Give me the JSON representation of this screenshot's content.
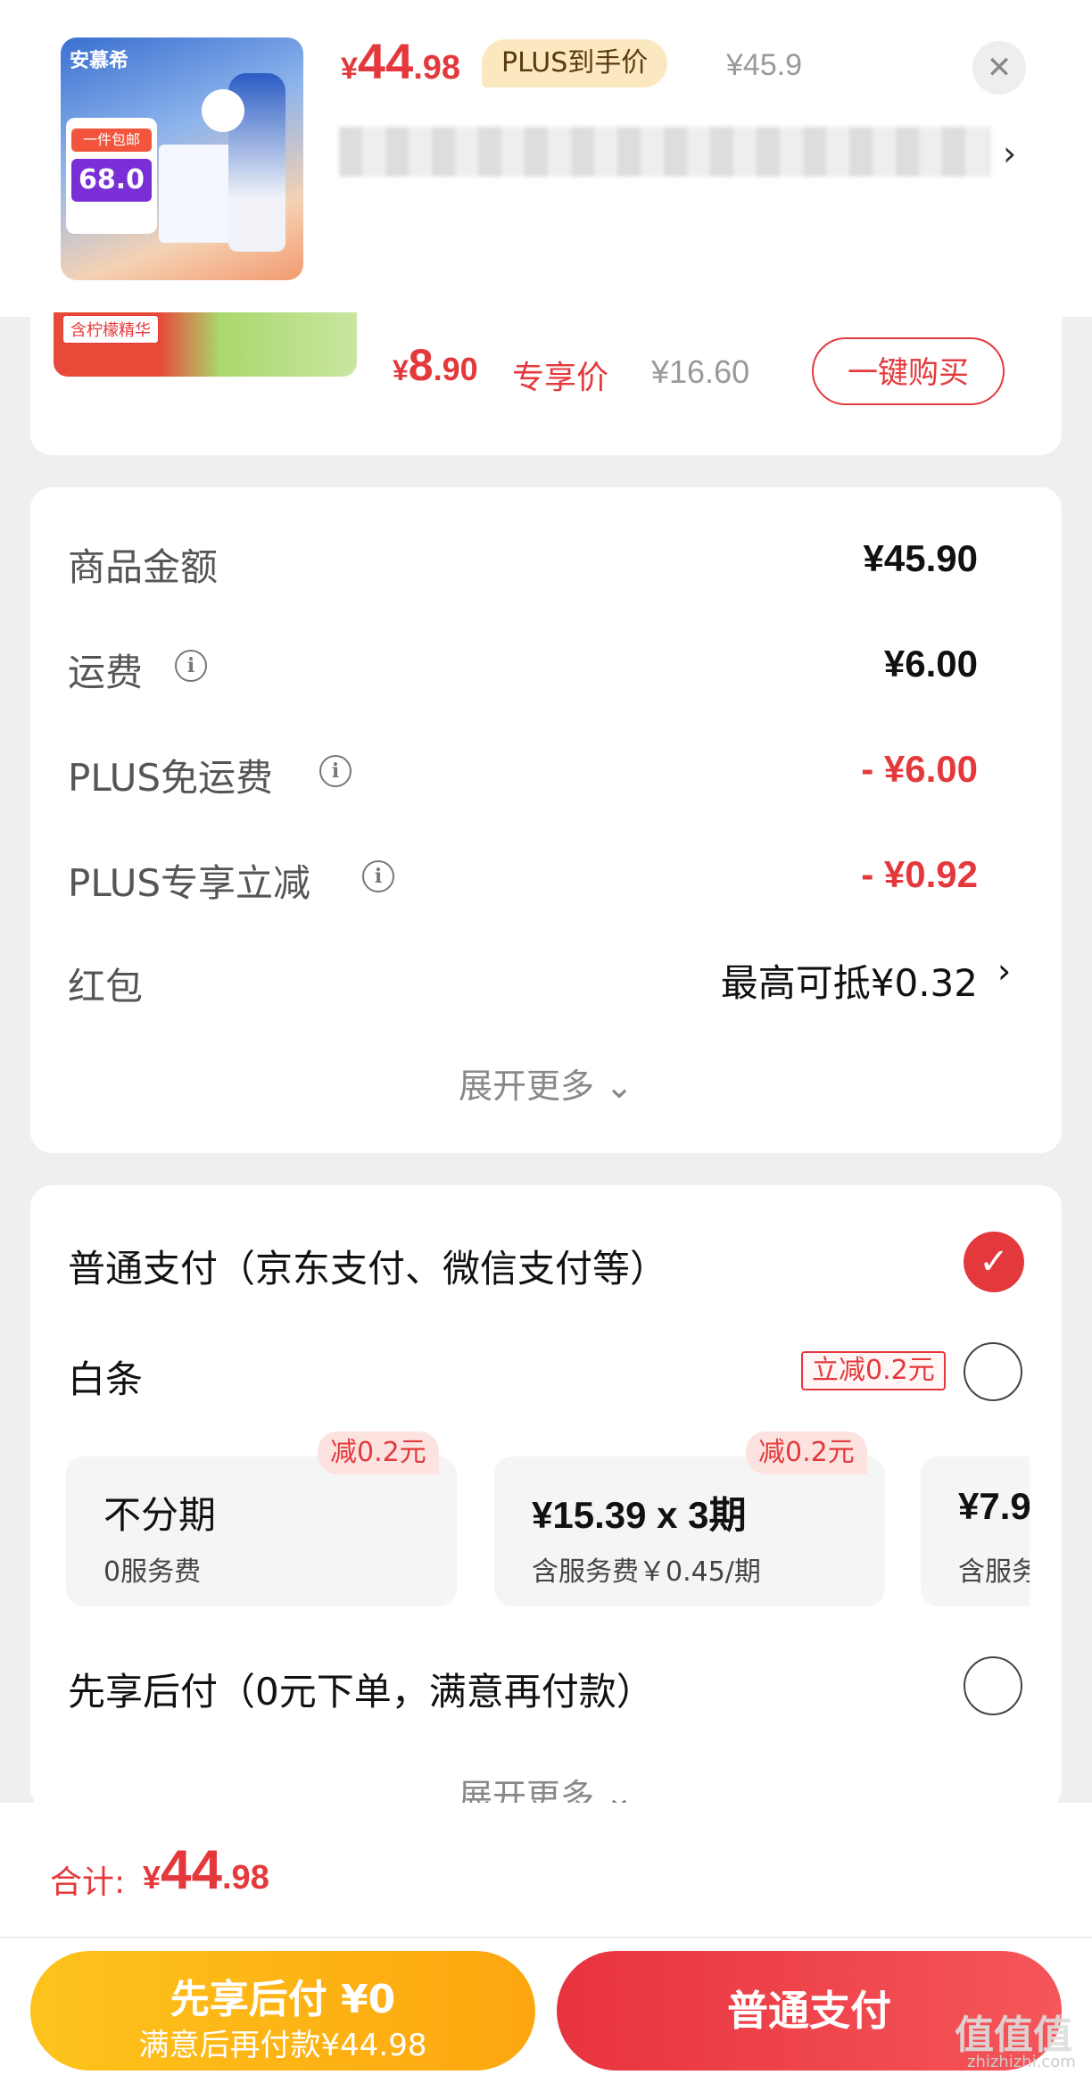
{
  "header": {
    "thumb": {
      "brand": "安慕希",
      "promo_top": "一件包邮",
      "promo_price": "68.0"
    },
    "price": {
      "symbol": "¥",
      "int": "44",
      "dec": ".98"
    },
    "plus_tag": "PLUS到手价",
    "orig_price": "¥45.9",
    "close_icon": "close-icon"
  },
  "recommend": {
    "label": "含柠檬精华",
    "price": {
      "symbol": "¥",
      "int": "8",
      "dec": ".90"
    },
    "tag": "专享价",
    "orig_price": "¥16.60",
    "buy_label": "一键购买"
  },
  "amounts": {
    "rows": [
      {
        "label": "商品金额",
        "value": "¥45.90"
      },
      {
        "label": "运费",
        "value": "¥6.00"
      },
      {
        "label": "PLUS免运费",
        "value": "- ¥6.00"
      },
      {
        "label": "PLUS专享立减",
        "value": "- ¥0.92"
      },
      {
        "label": "红包",
        "value": "最高可抵¥0.32"
      }
    ],
    "expand": "展开更多"
  },
  "payment": {
    "normal": "普通支付（京东支付、微信支付等）",
    "baitiao": "白条",
    "baitiao_tag": "立减0.2元",
    "plans": [
      {
        "badge": "减0.2元",
        "title": "不分期",
        "sub": "0服务费"
      },
      {
        "badge": "减0.2元",
        "title": "¥15.39 x 3期",
        "sub": "含服务费￥0.45/期"
      },
      {
        "badge": "",
        "title": "¥7.9",
        "sub": "含服务"
      }
    ],
    "later": "先享后付（0元下单，满意再付款）",
    "expand": "展开更多"
  },
  "bottom": {
    "total_label": "合计:",
    "total": {
      "symbol": "¥",
      "int": "44",
      "dec": ".98"
    },
    "btn_later_title": "先享后付 ¥0",
    "btn_later_sub": "满意后再付款¥44.98",
    "btn_pay": "普通支付"
  },
  "watermark": {
    "main": "值值值",
    "sub": "zhizhizhi.com"
  }
}
